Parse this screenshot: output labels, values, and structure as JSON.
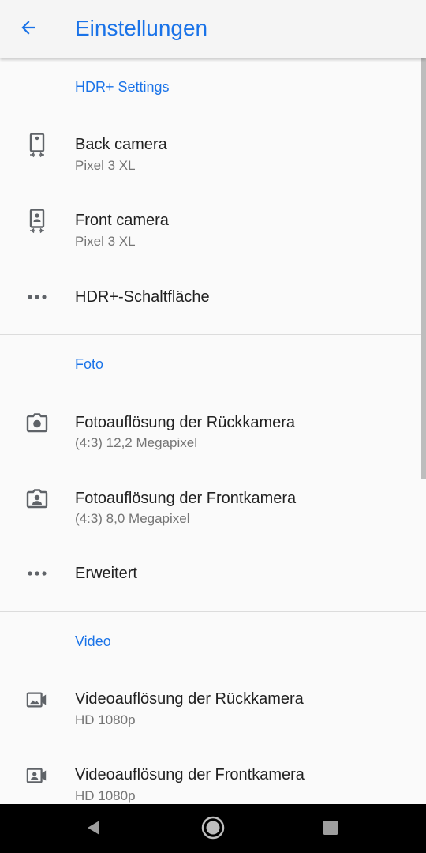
{
  "appbar": {
    "title": "Einstellungen"
  },
  "sections": {
    "hdr": {
      "header": "HDR+ Settings",
      "back_camera": {
        "title": "Back camera",
        "subtitle": "Pixel 3 XL"
      },
      "front_camera": {
        "title": "Front camera",
        "subtitle": "Pixel 3 XL"
      },
      "hdr_button": {
        "title": "HDR+-Schaltfläche"
      }
    },
    "photo": {
      "header": "Foto",
      "back_resolution": {
        "title": "Fotoauflösung der Rückkamera",
        "subtitle": "(4:3) 12,2 Megapixel"
      },
      "front_resolution": {
        "title": "Fotoauflösung der Frontkamera",
        "subtitle": "(4:3) 8,0 Megapixel"
      },
      "advanced": {
        "title": "Erweitert"
      }
    },
    "video": {
      "header": "Video",
      "back_resolution": {
        "title": "Videoauflösung der Rückkamera",
        "subtitle": "HD 1080p"
      },
      "front_resolution": {
        "title": "Videoauflösung der Frontkamera",
        "subtitle": "HD 1080p"
      }
    }
  },
  "colors": {
    "accent": "#1a73e8",
    "primary_text": "#212121",
    "secondary_text": "#757575",
    "icon": "#5f6368",
    "background": "#fafafa",
    "navbar": "#000000"
  },
  "icons": {
    "back": "arrow-back-icon",
    "back_camera": "phone-back-camera-icon",
    "front_camera": "phone-front-camera-icon",
    "more": "more-horiz-icon",
    "photo_back": "camera-icon",
    "photo_front": "portrait-camera-icon",
    "video_back": "video-landscape-icon",
    "video_front": "video-portrait-icon"
  }
}
